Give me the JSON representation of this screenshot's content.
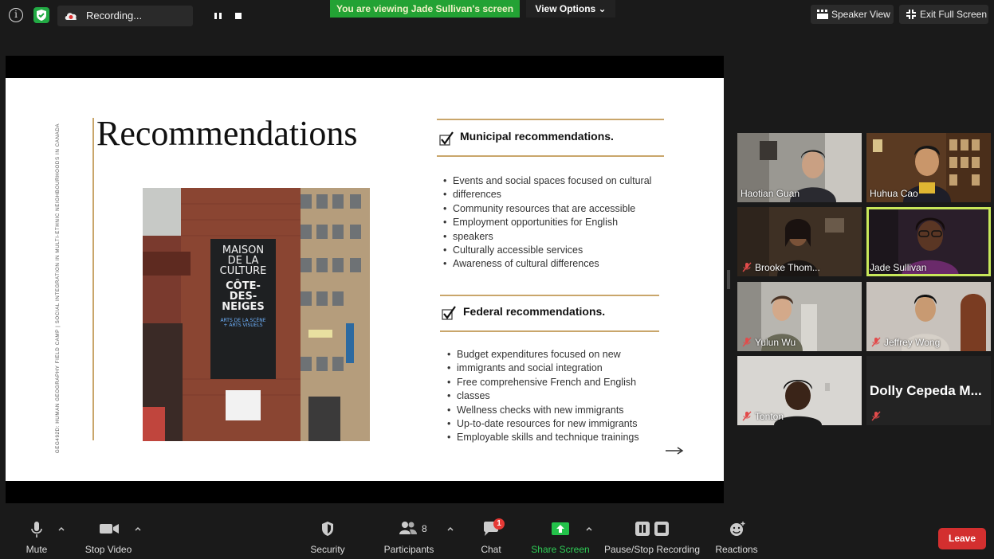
{
  "top_bar": {
    "recording_label": "Recording...",
    "viewing_banner": "You are viewing Jade Sullivan's screen",
    "view_options": "View Options ⌄",
    "speaker_view": "Speaker View",
    "exit_full_screen": "Exit Full Screen"
  },
  "slide": {
    "vertical_text": "GEG492D: HUMAN GEOGRAPHY FIELD CAMP | SOCIAL INTEGRATION IN MULTI-ETHNIC NEIGHBOURHOODS IN CANADA",
    "title": "Recommendations",
    "photo_sign": [
      "MAISON",
      "DE LA",
      "CULTURE",
      "CÔTE-",
      "DES-",
      "NEIGES",
      "ARTS DE LA SCÈNE",
      "+ ARTS VISUELS"
    ],
    "municipal_heading": "Municipal recommendations.",
    "municipal_items": [
      "Events and social spaces focused on cultural",
      "differences",
      "Community resources that are accessible",
      "Employment opportunities for English",
      "speakers",
      "Culturally accessible services",
      "Awareness of cultural differences"
    ],
    "federal_heading": "Federal recommendations.",
    "federal_items": [
      "Budget expenditures focused on new",
      "immigrants and social integration",
      "Free comprehensive French and English",
      "classes",
      "Wellness checks with new immigrants",
      "Up-to-date resources for new immigrants",
      "Employable skills and technique trainings"
    ]
  },
  "participants_gallery": [
    {
      "name": "Haotian Guan",
      "muted": false
    },
    {
      "name": "Huhua Cao",
      "muted": false
    },
    {
      "name": "Brooke Thom...",
      "muted": true
    },
    {
      "name": "Jade Sullivan",
      "muted": false,
      "active_speaker": true
    },
    {
      "name": "Yulun Wu",
      "muted": true
    },
    {
      "name": "Jeffrey Wong",
      "muted": true
    },
    {
      "name": "Tonton",
      "muted": true
    },
    {
      "name": "Dolly Cepeda M...",
      "muted": true,
      "video_off": true
    }
  ],
  "toolbar": {
    "mute": "Mute",
    "stop_video": "Stop Video",
    "security": "Security",
    "participants": "Participants",
    "participants_count": "8",
    "chat": "Chat",
    "chat_badge": "1",
    "share_screen": "Share Screen",
    "pause_stop_recording": "Pause/Stop Recording",
    "reactions": "Reactions",
    "leave": "Leave"
  },
  "colors": {
    "background": "#1a1a1a",
    "banner_green": "#23a234",
    "active_speaker": "#c8e85a",
    "leave_red": "#d32f2f",
    "slide_accent": "#c9a66b"
  }
}
